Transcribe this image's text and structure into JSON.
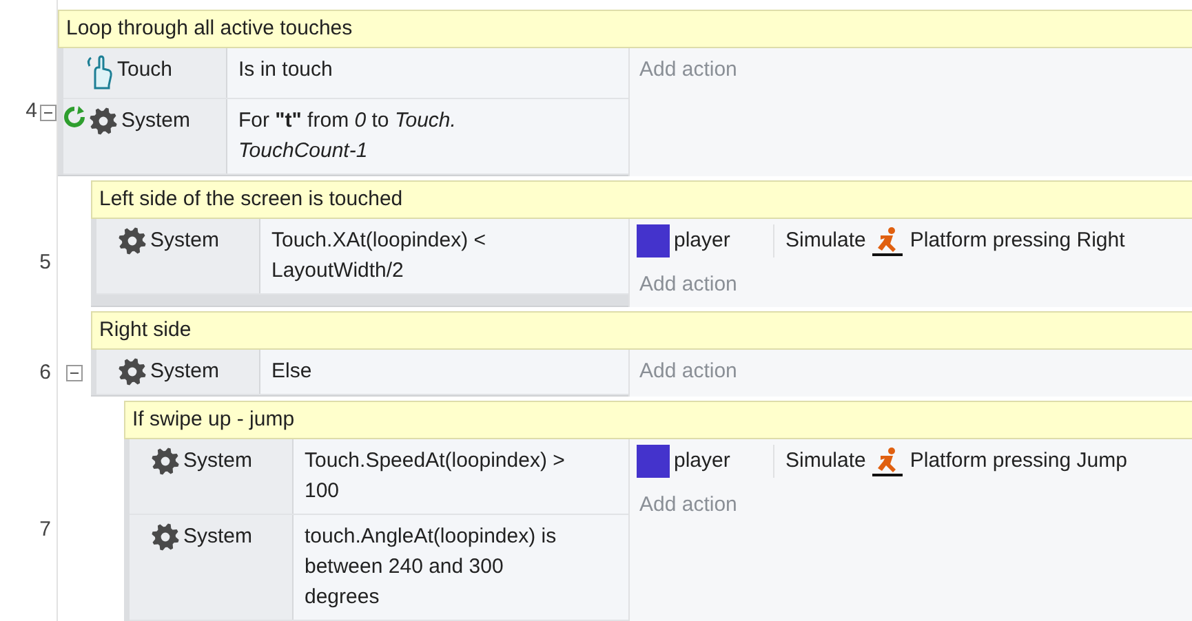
{
  "events": [
    {
      "number": "4",
      "expanded": true,
      "comment": "Loop through all active touches",
      "conditions": [
        {
          "object": "Touch",
          "kind": "touch",
          "loop": false,
          "text": "Is in touch"
        },
        {
          "object": "System",
          "kind": "system",
          "loop": true,
          "text": "For **\"t\"** from *0* to *Touch. TouchCount-1*"
        }
      ],
      "add_action": "Add action",
      "children": [
        {
          "number": "5",
          "comment": "Left side of the screen is touched",
          "conditions": [
            {
              "object": "System",
              "kind": "system",
              "loop": false,
              "text": "Touch.XAt(loopindex) < LayoutWidth/2"
            }
          ],
          "actions": [
            {
              "object": "player",
              "color": "#4433cc",
              "verb": "Simulate",
              "behavior": "Platform pressing Right"
            }
          ],
          "add_action": "Add action"
        },
        {
          "number": "6",
          "expanded": true,
          "comment": "Right side",
          "conditions": [
            {
              "object": "System",
              "kind": "system",
              "loop": false,
              "text": "Else"
            }
          ],
          "add_action": "Add action",
          "children": [
            {
              "number": "7",
              "comment": "If swipe up - jump",
              "conditions": [
                {
                  "object": "System",
                  "kind": "system",
                  "loop": false,
                  "text": "Touch.SpeedAt(loopindex) > 100"
                },
                {
                  "object": "System",
                  "kind": "system",
                  "loop": false,
                  "text": "touch.AngleAt(loopindex) is between 240 and 300 degrees"
                }
              ],
              "actions": [
                {
                  "object": "player",
                  "color": "#4433cc",
                  "verb": "Simulate",
                  "behavior": "Platform pressing Jump"
                }
              ],
              "add_action": "Add action"
            }
          ]
        }
      ]
    }
  ]
}
